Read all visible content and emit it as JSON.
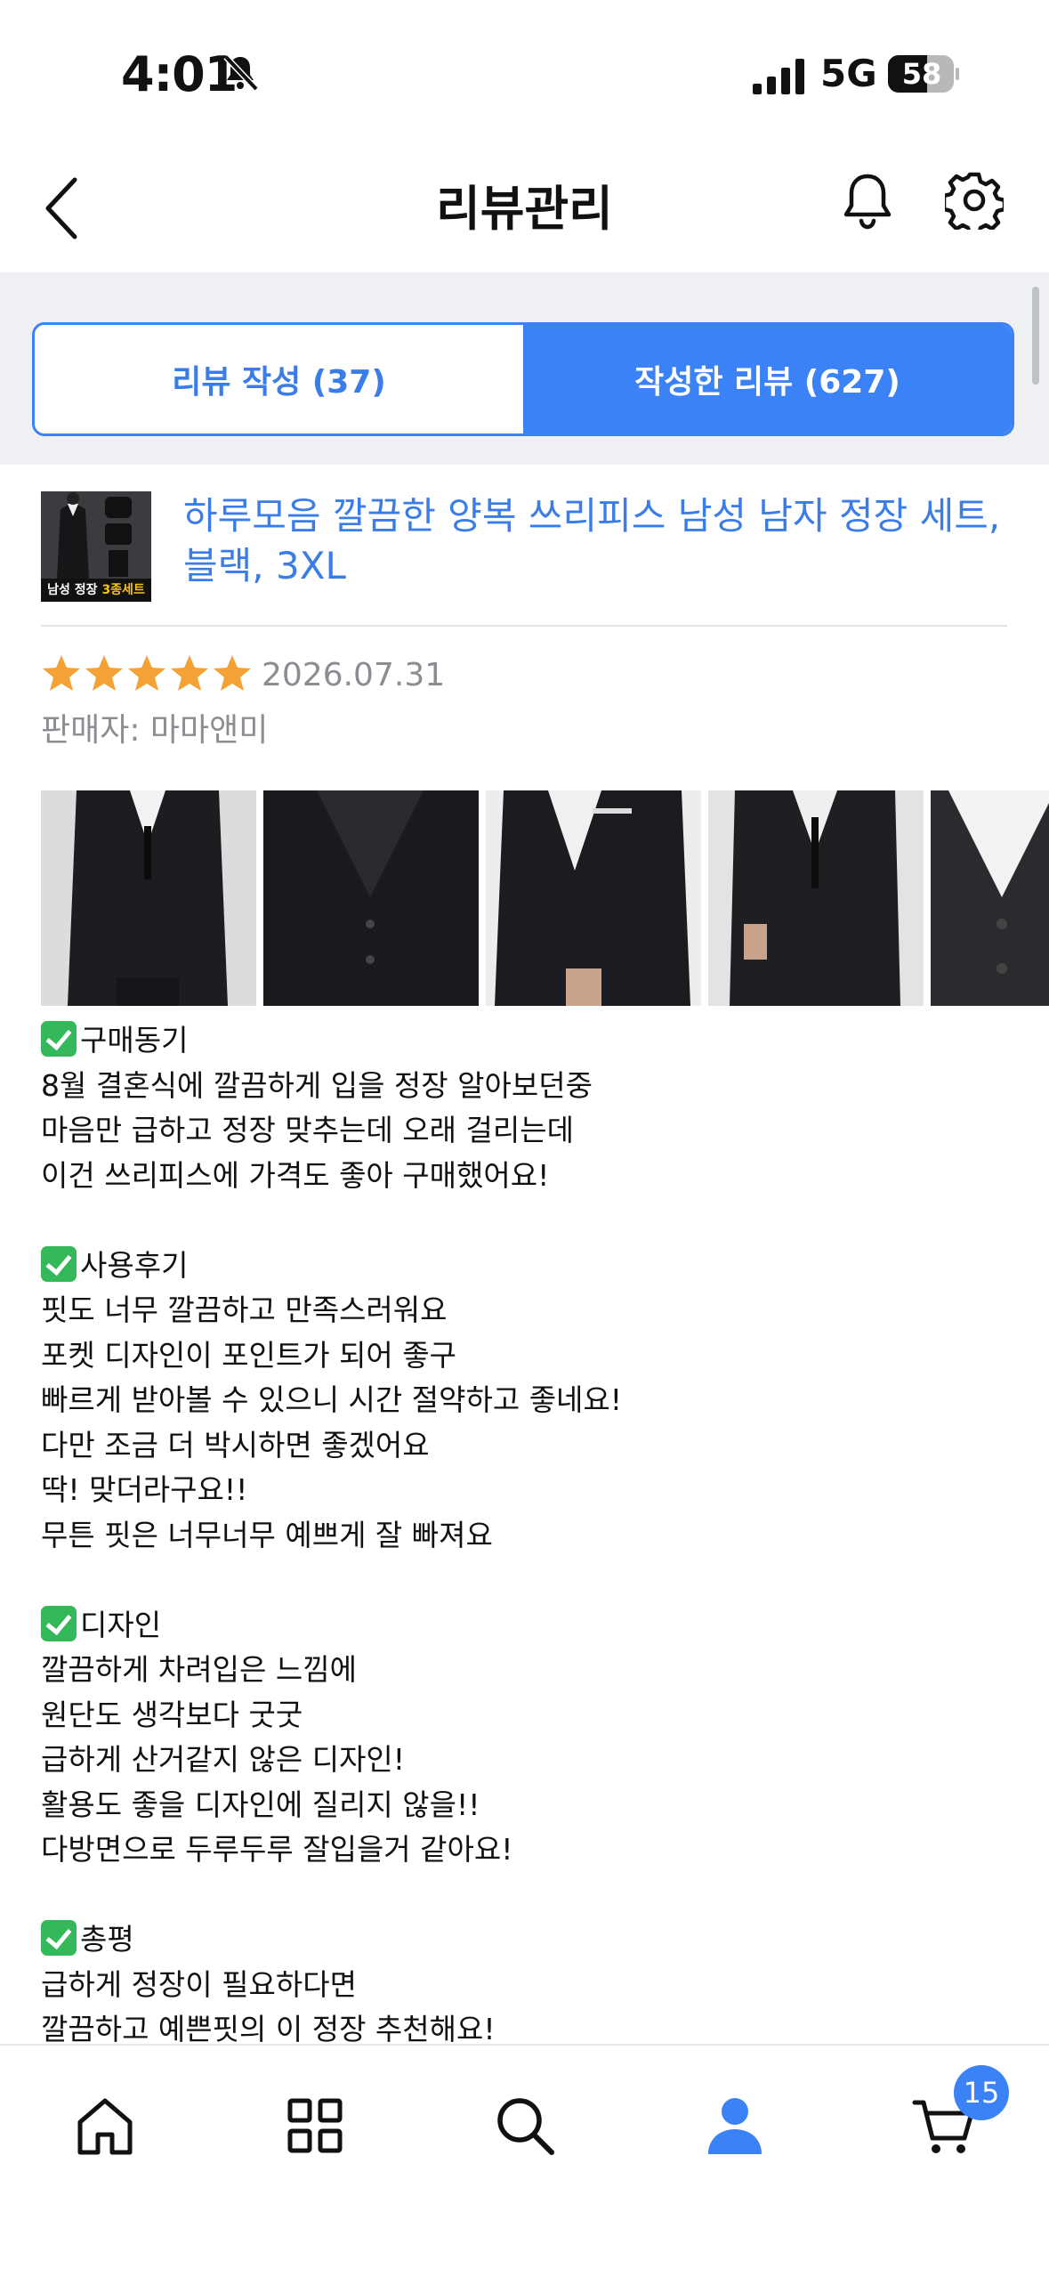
{
  "status_bar": {
    "time": "4:01",
    "network": "5G",
    "battery": "58"
  },
  "header": {
    "title": "리뷰관리"
  },
  "tabs": [
    {
      "label": "리뷰 작성 (37)"
    },
    {
      "label": "작성한 리뷰 (627)"
    }
  ],
  "product": {
    "name": "하루모음 깔끔한 양복 쓰리피스 남성 남자 정장 세트, 블랙, 3XL",
    "thumb_label_white": "남성 정장 ",
    "thumb_label_yellow": "3종세트"
  },
  "review": {
    "rating": 5,
    "date": "2026.07.31",
    "seller": "판매자: 마마앤미",
    "photo_count": 5,
    "sections": [
      {
        "heading": "구매동기",
        "lines": [
          "8월 결혼식에 깔끔하게 입을 정장 알아보던중",
          "마음만 급하고 정장 맞추는데 오래 걸리는데",
          "이건 쓰리피스에 가격도 좋아 구매했어요!"
        ]
      },
      {
        "heading": "사용후기",
        "lines": [
          "핏도 너무 깔끔하고 만족스러워요",
          "포켓 디자인이 포인트가 되어 좋구",
          "빠르게 받아볼 수 있으니 시간 절약하고 좋네요!",
          "다만 조금 더 박시하면 좋겠어요",
          "딱! 맞더라구요!!",
          "무튼 핏은 너무너무 예쁘게 잘 빠져요"
        ]
      },
      {
        "heading": "디자인",
        "lines": [
          "깔끔하게 차려입은 느낌에",
          "원단도 생각보다 굿굿",
          "급하게 산거같지 않은 디자인!",
          "활용도 좋을 디자인에 질리지 않을!!",
          "다방면으로 두루두루 잘입을거 같아요!"
        ]
      },
      {
        "heading": "총평",
        "lines": [
          "급하게 정장이 필요하다면",
          "깔끔하고 예쁜핏의 이 정장 추천해요!"
        ]
      }
    ]
  },
  "bottom_nav": {
    "items": [
      "home-icon",
      "grid-icon",
      "search-icon",
      "profile-icon",
      "cart-icon"
    ],
    "cart_badge": "15"
  },
  "colors": {
    "accent": "#3b82f6",
    "star": "#f4a236",
    "check": "#33b85a"
  }
}
